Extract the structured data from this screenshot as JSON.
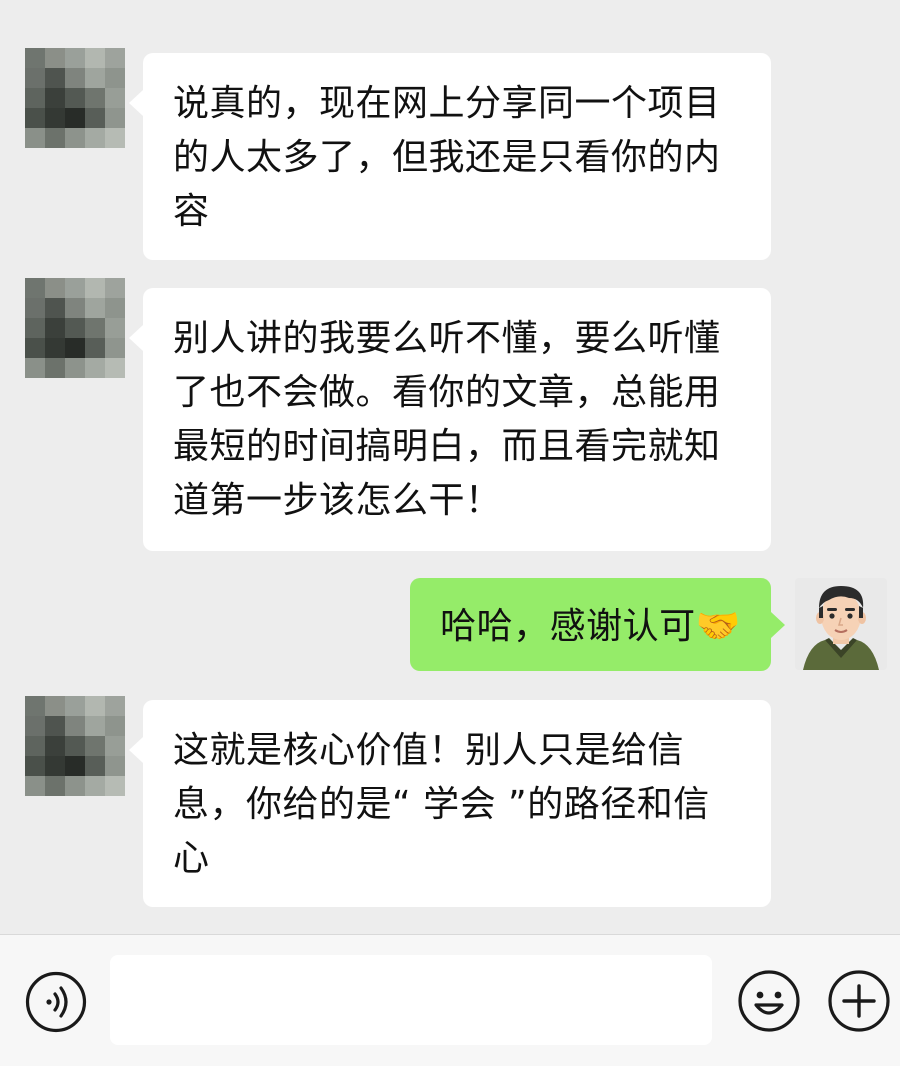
{
  "messages": [
    {
      "from": "contact",
      "avatar": "blurred-avatar",
      "lines": [
        "说真的，现在网上分享同一个项目",
        "的人太多了，但我还是只看你的内",
        "容"
      ]
    },
    {
      "from": "contact",
      "avatar": "blurred-avatar",
      "lines": [
        "别人讲的我要么听不懂，要么听懂",
        "了也不会做。看你的文章，总能用",
        "最短的时间搞明白，而且看完就知",
        "道第一步该怎么干！"
      ]
    },
    {
      "from": "me",
      "avatar": "cartoon-man-avatar",
      "text": "哈哈，感谢认可",
      "emoji": "🤝"
    },
    {
      "from": "contact",
      "avatar": "blurred-avatar",
      "lines": [
        "这就是核心价值！别人只是给信",
        "息，你给的是“ 学会 ”的路径和信",
        "心"
      ]
    }
  ],
  "input_bar": {
    "text_value": "",
    "icons": [
      "voice-icon",
      "emoji-icon",
      "plus-icon"
    ]
  },
  "colors": {
    "background": "#ededed",
    "bubble_incoming": "#ffffff",
    "bubble_outgoing": "#95ec69",
    "input_bar": "#f7f7f7"
  }
}
